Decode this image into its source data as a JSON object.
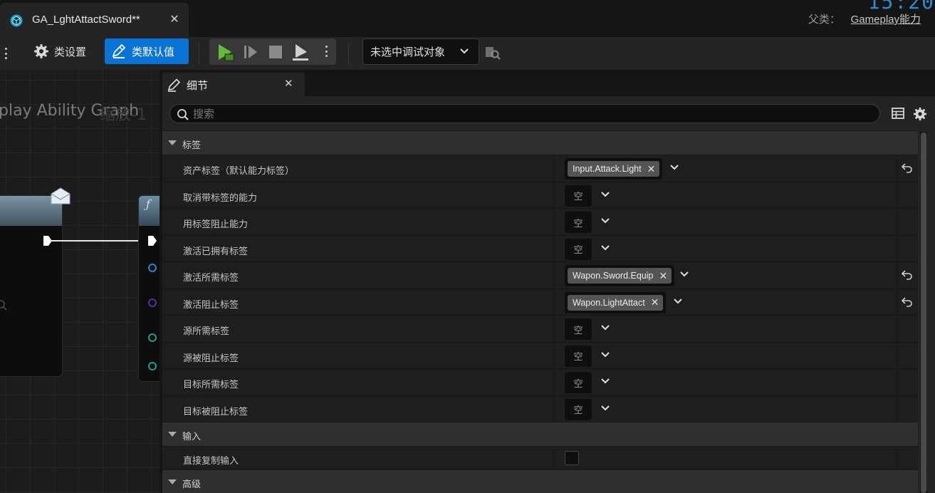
{
  "tab": {
    "title": "GA_LghtAttactSword**",
    "close": "✕"
  },
  "header": {
    "parent_label": "父类：",
    "parent_value": "Gameplay能力",
    "clock": "15:20"
  },
  "toolbar": {
    "class_settings": "类设置",
    "class_defaults": "类默认值",
    "debug_target": "未选中调试对象"
  },
  "graph": {
    "title": "play Ability Graph",
    "zoom": "缩放-1"
  },
  "details": {
    "tab_title": "细节",
    "tab_close": "✕",
    "search_placeholder": "搜索",
    "categories": {
      "tags": "标签",
      "input": "输入",
      "advanced": "高级"
    },
    "tag_rows": [
      {
        "name": "资产标签（默认能力标签）",
        "tag": "Input.Attack.Light"
      },
      {
        "name": "取消带标签的能力",
        "empty": "空"
      },
      {
        "name": "用标签阻止能力",
        "empty": "空"
      },
      {
        "name": "激活已拥有标签",
        "empty": "空"
      },
      {
        "name": "激活所需标签",
        "tag": "Wapon.Sword.Equip"
      },
      {
        "name": "激活阻止标签",
        "tag": "Wapon.LightAttact"
      },
      {
        "name": "源所需标签",
        "empty": "空"
      },
      {
        "name": "源被阻止标签",
        "empty": "空"
      },
      {
        "name": "目标所需标签",
        "empty": "空"
      },
      {
        "name": "目标被阻止标签",
        "empty": "空"
      }
    ],
    "input_rows": [
      {
        "name": "直接复制输入",
        "checked": false
      }
    ]
  },
  "colors": {
    "accent": "#0a74d6",
    "play": "#5fbf3a",
    "chip": "#545454",
    "panel": "#242424"
  }
}
